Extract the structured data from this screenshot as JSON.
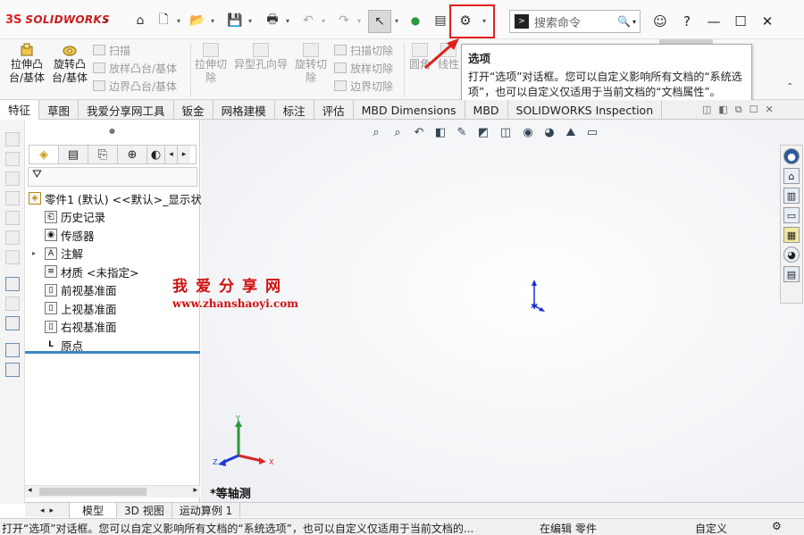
{
  "app": {
    "brand": "SOLIDWORKS",
    "brand_mark": "3S"
  },
  "titlebar": {
    "home": "⌂",
    "new": "🗋",
    "open": "📂",
    "save": "💾",
    "print": "🖶",
    "undo": "↶",
    "redo": "↷",
    "select": "↖",
    "traffic": "●",
    "filegrid": "▤",
    "options": "⚙",
    "dropdown": "▾",
    "arrow": "›",
    "search_placeholder": "搜索命令",
    "search_icon": "🔍",
    "terminal_icon": ">",
    "user": "☺",
    "help": "?",
    "minimize": "—",
    "maximize": "☐",
    "close": "✕"
  },
  "ribbon": {
    "extrude_boss": "拉伸凸台/基体",
    "revolve_boss": "旋转凸台/基体",
    "sweep": "扫描",
    "loft": "放样凸台/基体",
    "boundary": "边界凸台/基体",
    "extrude_cut": "拉伸切除",
    "hole_wizard": "异型孔向导",
    "revolve_cut": "旋转切除",
    "sweep_cut": "扫描切除",
    "loft_cut": "放样切除",
    "boundary_cut": "边界切除",
    "fillet": "圆角",
    "linear": "线性"
  },
  "tooltip": {
    "title": "选项",
    "body": "打开“选项”对话框。您可以自定义影响所有文档的“系统选项”，也可以自定义仅适用于当前文档的“文档属性”。"
  },
  "tabs": [
    "特征",
    "草图",
    "我爱分享网工具",
    "钣金",
    "网格建模",
    "标注",
    "评估",
    "MBD Dimensions",
    "MBD",
    "SOLIDWORKS Inspection"
  ],
  "featuremanager": {
    "filter_icon": "⛛",
    "tree": [
      {
        "label": "零件1 (默认) <<默认>_显示状",
        "icon": "◈"
      },
      {
        "label": "历史记录",
        "icon": "⎗"
      },
      {
        "label": "传感器",
        "icon": "◉"
      },
      {
        "label": "注解",
        "icon": "A"
      },
      {
        "label": "材质 <未指定>",
        "icon": "≡"
      },
      {
        "label": "前视基准面",
        "icon": "▯"
      },
      {
        "label": "上视基准面",
        "icon": "▯"
      },
      {
        "label": "右视基准面",
        "icon": "▯"
      },
      {
        "label": "原点",
        "icon": "L"
      }
    ]
  },
  "watermark": {
    "line1": "我爱分享网",
    "line2": "www.zhanshaoyi.com"
  },
  "viewport": {
    "view_label": "*等轴测",
    "triad": {
      "x": "X",
      "y": "Y",
      "z": "Z"
    }
  },
  "bottom_tabs": [
    "模型",
    "3D 视图",
    "运动算例 1"
  ],
  "status": {
    "message": "打开“选项”对话框。您可以自定义影响所有文档的“系统选项”，也可以自定义仅适用于当前文档的...",
    "mode": "在编辑 零件",
    "units": "自定义"
  },
  "colors": {
    "highlight": "#e0201c",
    "accent": "#3a86c8",
    "brand": "#c81e1e"
  }
}
